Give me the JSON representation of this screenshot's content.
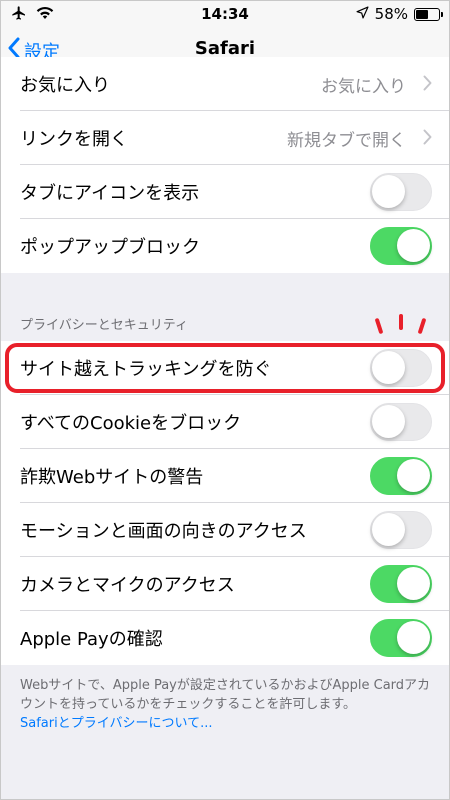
{
  "status_bar": {
    "time": "14:34",
    "battery": "58%",
    "battery_level": 0.58,
    "icons": [
      "airplane-icon",
      "wifi-icon",
      "location-arrow-icon",
      "battery-icon"
    ]
  },
  "nav": {
    "back_label": "設定",
    "title": "Safari"
  },
  "group1": [
    {
      "label": "お気に入り",
      "value": "お気に入り",
      "type": "disclosure"
    },
    {
      "label": "リンクを開く",
      "value": "新規タブで開く",
      "type": "disclosure"
    },
    {
      "label": "タブにアイコンを表示",
      "type": "toggle",
      "on": false
    },
    {
      "label": "ポップアップブロック",
      "type": "toggle",
      "on": true
    }
  ],
  "privacy": {
    "header": "プライバシーとセキュリティ",
    "rows": [
      {
        "label": "サイト越えトラッキングを防ぐ",
        "type": "toggle",
        "on": false
      },
      {
        "label": "すべてのCookieをブロック",
        "type": "toggle",
        "on": false
      },
      {
        "label": "詐欺Webサイトの警告",
        "type": "toggle",
        "on": true
      },
      {
        "label": "モーションと画面の向きのアクセス",
        "type": "toggle",
        "on": false
      },
      {
        "label": "カメラとマイクのアクセス",
        "type": "toggle",
        "on": true
      },
      {
        "label": "Apple Payの確認",
        "type": "toggle",
        "on": true
      }
    ],
    "footer_text": "Webサイトで、Apple Payが設定されているかおよびApple Cardアカウントを持っているかをチェックすることを許可します。",
    "footer_link": "Safariとプライバシーについて..."
  },
  "colors": {
    "accent": "#007aff",
    "toggle_on": "#4cd964",
    "highlight": "#e8202a"
  }
}
